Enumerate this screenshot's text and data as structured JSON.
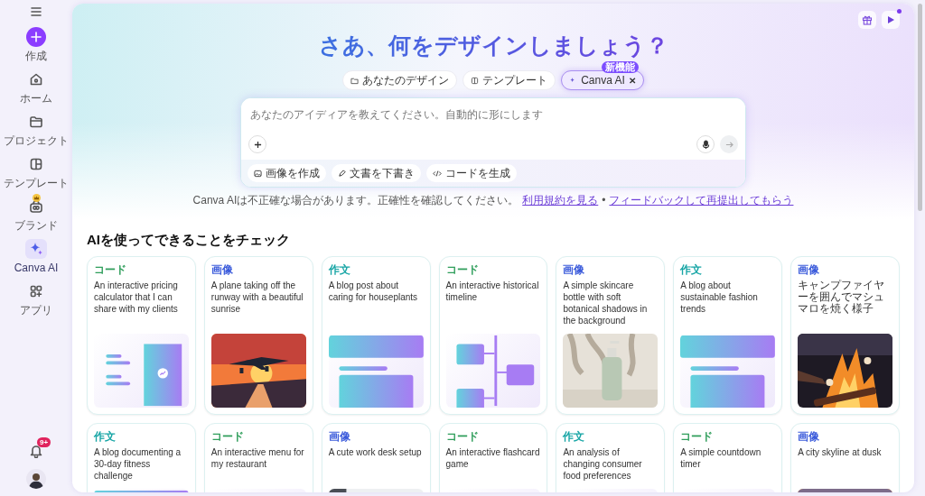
{
  "sidebar": {
    "items": [
      {
        "kind": "create",
        "label": "作成",
        "selected": false,
        "premium": false
      },
      {
        "kind": "nav",
        "label": "ホーム",
        "selected": false,
        "premium": false
      },
      {
        "kind": "nav",
        "label": "プロジェクト",
        "selected": false,
        "premium": false
      },
      {
        "kind": "nav",
        "label": "テンプレート",
        "selected": false,
        "premium": false
      },
      {
        "kind": "nav",
        "label": "ブランド",
        "selected": false,
        "premium": true
      },
      {
        "kind": "nav",
        "label": "Canva AI",
        "selected": true,
        "premium": false
      },
      {
        "kind": "nav",
        "label": "アプリ",
        "selected": false,
        "premium": false
      }
    ],
    "notifications": {
      "badge": "9+"
    }
  },
  "top_actions": {
    "play_dot": true
  },
  "hero": {
    "title": "さあ、何をデザインしましょう？",
    "tabs": [
      {
        "label": "あなたのデザイン",
        "selected": false
      },
      {
        "label": "テンプレート",
        "selected": false
      },
      {
        "label": "Canva AI",
        "selected": true,
        "badge": "新機能",
        "close": "✕"
      }
    ],
    "prompt": {
      "placeholder": "あなたのアイディアを教えてください。自動的に形にします",
      "send_disabled": true
    },
    "chips": [
      "画像を作成",
      "文書を下書き",
      "コードを生成"
    ],
    "disclaimer": {
      "text": "Canva AIは不正確な場合があります。正確性を確認してください。",
      "links": [
        "利用規約を見る",
        "フィードバックして再提出してもらう"
      ],
      "separator": "•"
    }
  },
  "examples": {
    "heading": "AIを使ってできることをチェック",
    "cards": [
      {
        "tag": "コード",
        "color": "#2f9e5b",
        "text": "An interactive pricing calculator that I can share with my clients",
        "preview": {
          "kind": "pricing"
        }
      },
      {
        "tag": "画像",
        "color": "#3b5bdb",
        "text": "A plane taking off the runway with a beautiful sunrise"
      },
      {
        "tag": "作文",
        "color": "#16a5a5",
        "text": "A blog post about caring for houseplants",
        "preview": {
          "kind": "blog"
        }
      },
      {
        "tag": "コード",
        "color": "#2f9e5b",
        "text": "An interactive historical timeline",
        "preview": {
          "kind": "timeline"
        }
      },
      {
        "tag": "画像",
        "color": "#3b5bdb",
        "text": "A simple skincare bottle with soft botanical shadows in the background"
      },
      {
        "tag": "作文",
        "color": "#16a5a5",
        "text": "A blog about sustainable fashion trends",
        "preview": {
          "kind": "blog"
        }
      },
      {
        "tag": "画像",
        "color": "#3b5bdb",
        "text": "キャンプファイヤーを囲んでマシュマロを焼く様子"
      },
      {
        "tag": "作文",
        "color": "#16a5a5",
        "text": "A blog documenting a 30-day fitness challenge",
        "preview": {
          "kind": "blog"
        }
      },
      {
        "tag": "コード",
        "color": "#2f9e5b",
        "text": "An interactive menu for my restaurant",
        "preview": {
          "kind": "menu"
        }
      },
      {
        "tag": "画像",
        "color": "#3b5bdb",
        "text": "A cute work desk setup"
      },
      {
        "tag": "コード",
        "color": "#2f9e5b",
        "text": "An interactive flashcard game",
        "preview": {
          "kind": "flashcard"
        }
      },
      {
        "tag": "作文",
        "color": "#16a5a5",
        "text": "An analysis of changing consumer food preferences",
        "preview": {
          "kind": "analysis"
        }
      },
      {
        "tag": "コード",
        "color": "#2f9e5b",
        "text": "A simple countdown timer",
        "preview": {
          "kind": "countdown"
        }
      },
      {
        "tag": "画像",
        "color": "#3b5bdb",
        "text": "A city skyline at dusk"
      }
    ]
  }
}
